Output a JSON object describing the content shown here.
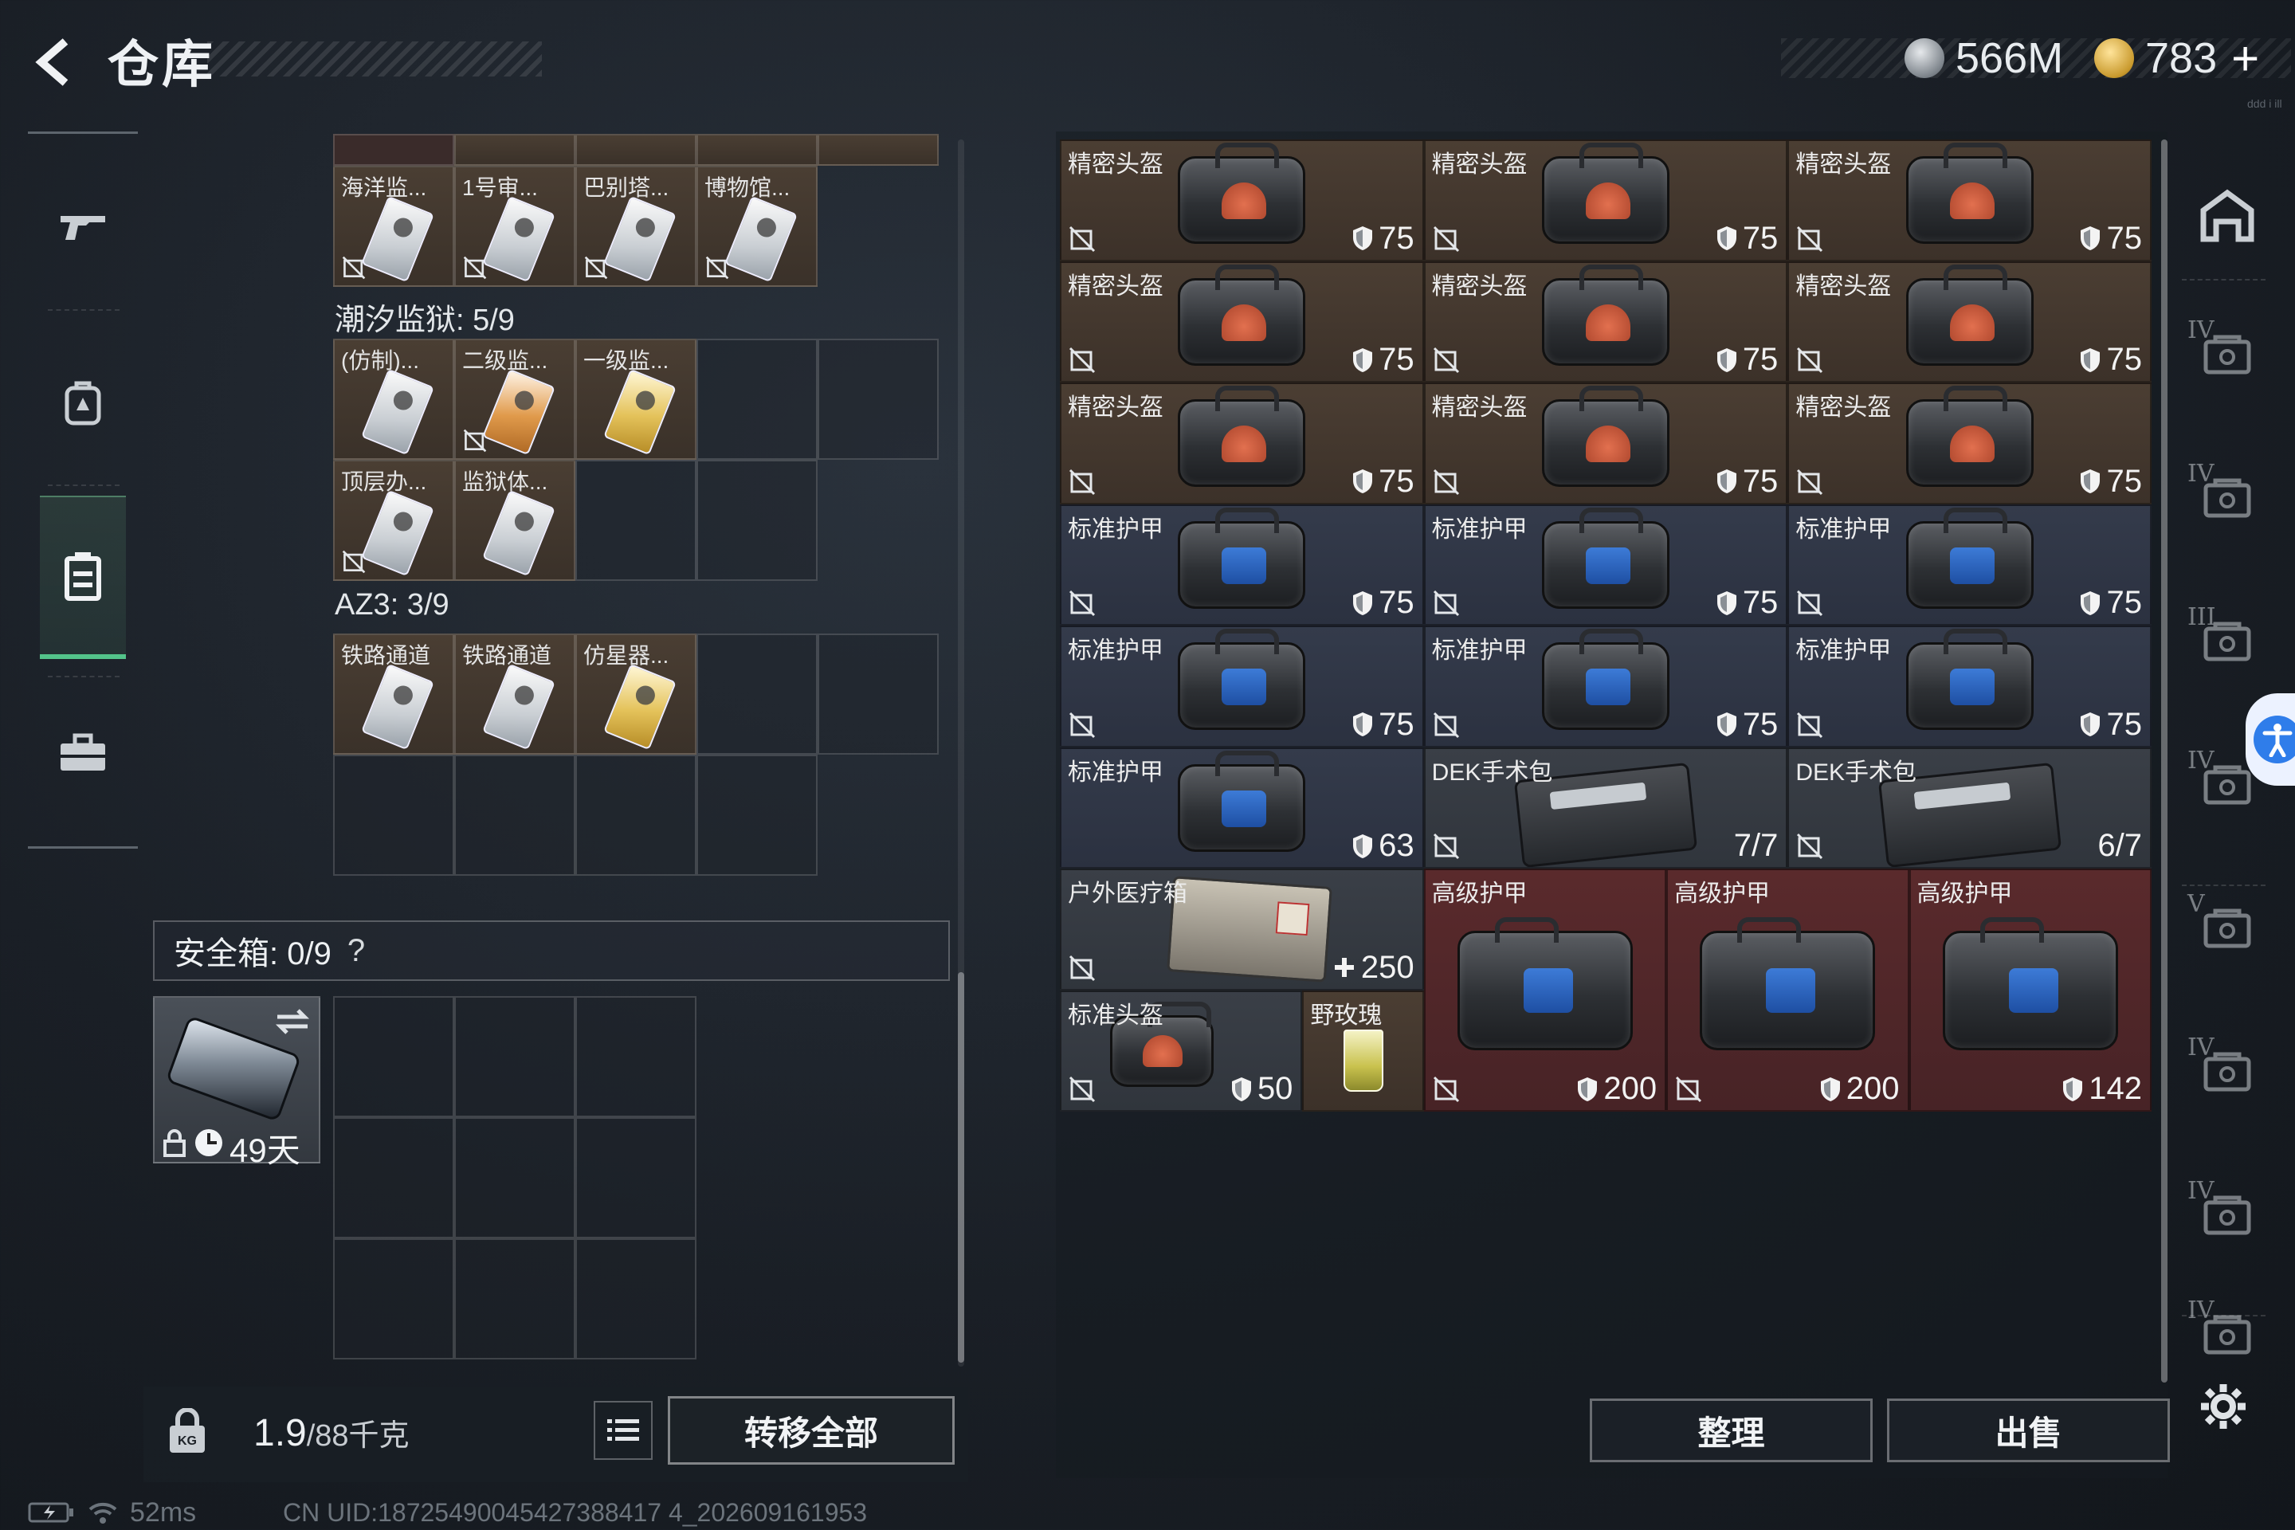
{
  "header": {
    "title": "仓库",
    "silver": "566M",
    "gold": "783",
    "gold_plus": "+",
    "corner_hint": "ddd i ill"
  },
  "left_nav": [
    "weapon",
    "backpack",
    "storage",
    "toolbox"
  ],
  "storage": {
    "group1_labels": [
      "海洋监...",
      "1号审...",
      "巴别塔...",
      "博物馆..."
    ],
    "group2_title": "潮汐监狱: 5/9",
    "group2_labels": [
      "(仿制)...",
      "二级监...",
      "一级监...",
      "顶层办...",
      "监狱体..."
    ],
    "group3_title": "AZ3: 3/9",
    "group3_labels": [
      "铁路通道",
      "铁路通道",
      "仿星器..."
    ]
  },
  "safe_box": {
    "label": "安全箱: 0/9",
    "help": "?",
    "timer": "49天"
  },
  "bottom": {
    "weight_value": "1.9",
    "weight_cap": "/88千克",
    "transfer_all": "转移全部"
  },
  "status": {
    "ping": "52ms",
    "uid": "CN UID:18725490045427388417 4_202609161953"
  },
  "items": {
    "precise_helmet": "精密头盔",
    "standard_armor": "标准护甲",
    "dek_kit": "DEK手术包",
    "outdoor_medkit": "户外医疗箱",
    "standard_helmet": "标准头盔",
    "wild_rose": "野玫瑰",
    "advanced_armor": "高级护甲",
    "v75": "75",
    "v63": "63",
    "dek1": "7/7",
    "dek2": "6/7",
    "med": "250",
    "v50": "50",
    "v200": "200",
    "v142": "142"
  },
  "right_nav": [
    "IV",
    "IV",
    "III",
    "IV",
    "V",
    "IV",
    "IV",
    "IV"
  ],
  "actions": {
    "sort": "整理",
    "sell": "出售"
  }
}
